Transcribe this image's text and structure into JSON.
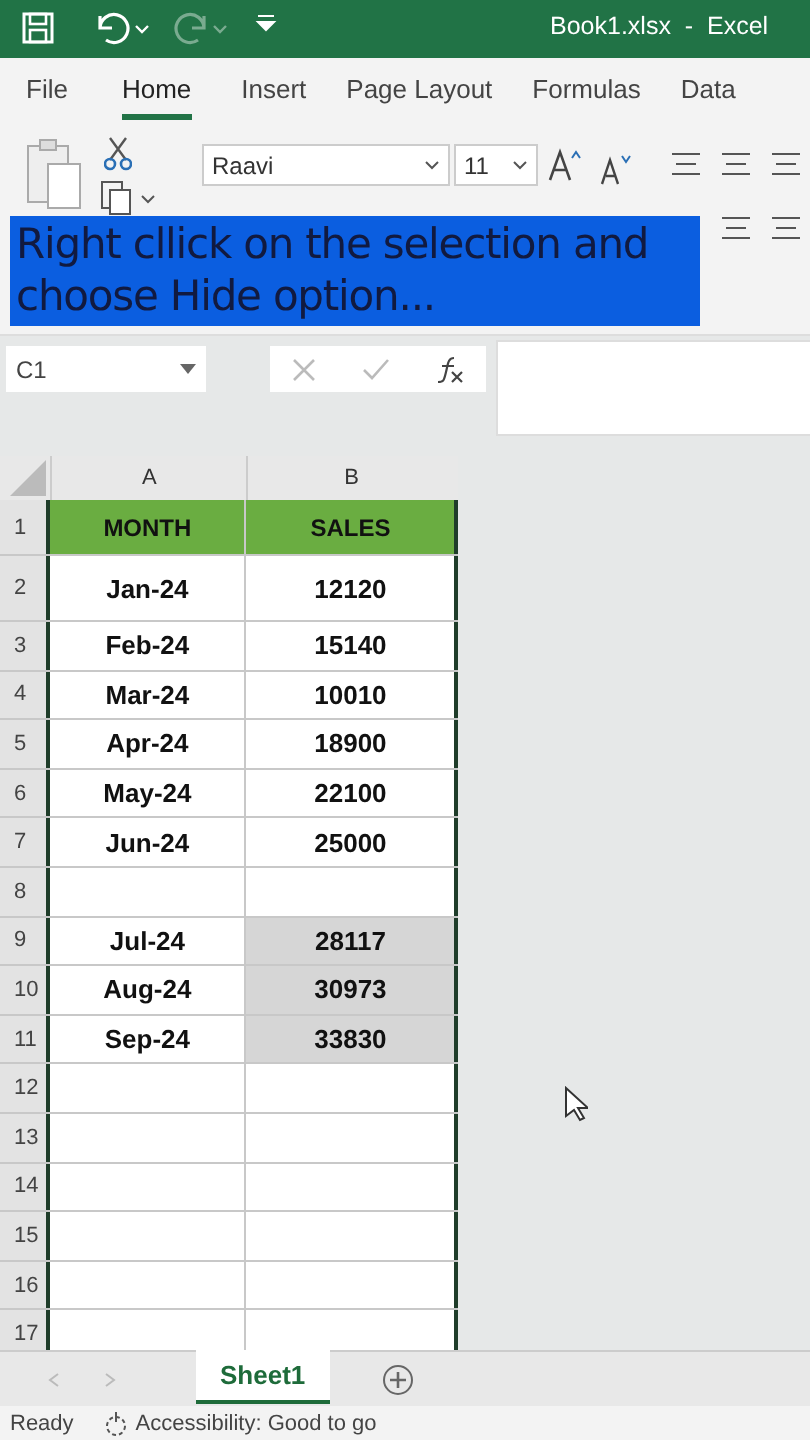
{
  "title_bar": {
    "title": "Book1.xlsx  -  Excel"
  },
  "tabs": [
    {
      "label": "File",
      "selected": false
    },
    {
      "label": "Home",
      "selected": true
    },
    {
      "label": "Insert",
      "selected": false
    },
    {
      "label": "Page Layout",
      "selected": false
    },
    {
      "label": "Formulas",
      "selected": false
    },
    {
      "label": "Data",
      "selected": false
    }
  ],
  "ribbon": {
    "font": "Raavi",
    "size": "11"
  },
  "caption": "Right cllick on the selection and choose Hide option...",
  "name_box": "C1",
  "sheet": {
    "columns": [
      "A",
      "B"
    ],
    "rows": [
      {
        "number": "1",
        "kind": "header",
        "month": "MONTH",
        "sales": "SALES",
        "selected": false
      },
      {
        "number": "2",
        "kind": "data",
        "month": "Jan-24",
        "sales": "12120",
        "selected": false
      },
      {
        "number": "3",
        "kind": "data",
        "month": "Feb-24",
        "sales": "15140",
        "selected": false
      },
      {
        "number": "4",
        "kind": "data",
        "month": "Mar-24",
        "sales": "10010",
        "selected": false
      },
      {
        "number": "5",
        "kind": "data",
        "month": "Apr-24",
        "sales": "18900",
        "selected": false
      },
      {
        "number": "6",
        "kind": "data",
        "month": "May-24",
        "sales": "22100",
        "selected": false
      },
      {
        "number": "7",
        "kind": "data",
        "month": "Jun-24",
        "sales": "25000",
        "selected": false
      },
      {
        "number": "8",
        "kind": "empty",
        "selected": false
      },
      {
        "number": "9",
        "kind": "data",
        "month": "Jul-24",
        "sales": "28117",
        "selected": true
      },
      {
        "number": "10",
        "kind": "data",
        "month": "Aug-24",
        "sales": "30973",
        "selected": true
      },
      {
        "number": "11",
        "kind": "data",
        "month": "Sep-24",
        "sales": "33830",
        "selected": true
      },
      {
        "number": "12",
        "kind": "empty",
        "selected": false
      },
      {
        "number": "13",
        "kind": "empty",
        "selected": false
      },
      {
        "number": "14",
        "kind": "empty",
        "selected": false
      },
      {
        "number": "15",
        "kind": "empty",
        "selected": false
      },
      {
        "number": "16",
        "kind": "empty",
        "selected": false
      },
      {
        "number": "17",
        "kind": "empty",
        "selected": false
      }
    ]
  },
  "sheet_tabs": [
    {
      "label": "Sheet1",
      "selected": true
    }
  ],
  "status_bar": {
    "mode": "Ready",
    "accessibility": "Accessibility: Good to go"
  }
}
